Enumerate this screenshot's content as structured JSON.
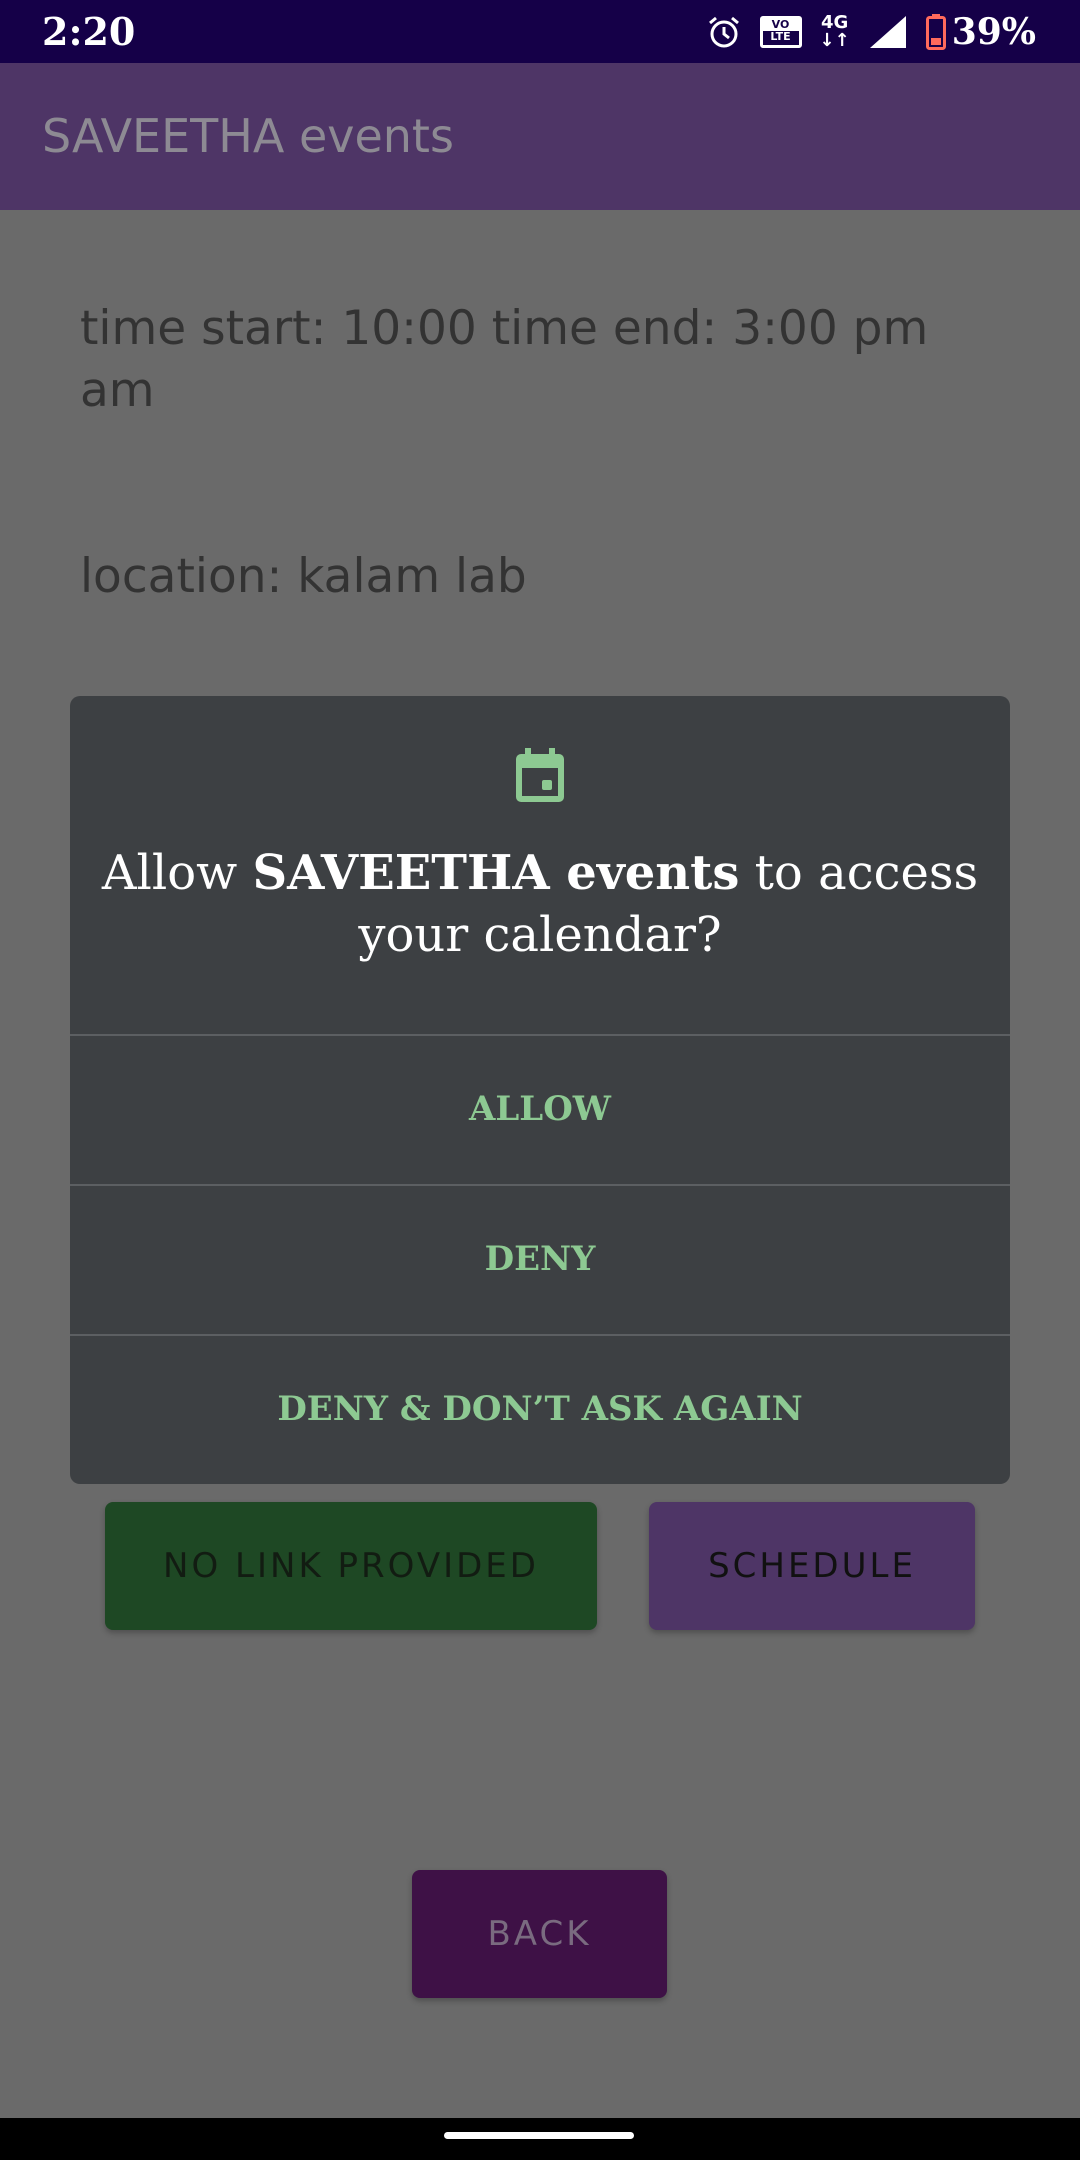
{
  "status_bar": {
    "time": "2:20",
    "volte_top": "VO",
    "volte_bottom": "LTE",
    "network": "4G",
    "network_arrows": "↓↑",
    "battery_percent": "39%",
    "icons": [
      "alarm-icon",
      "volte-icon",
      "network-4g-icon",
      "signal-icon",
      "battery-low-icon"
    ]
  },
  "app_bar": {
    "title": "SAVEETHA events"
  },
  "event": {
    "time_line": "time start: 10:00  time end: 3:00 pm am",
    "location_line": "location: kalam lab"
  },
  "buttons": {
    "no_link": "NO LINK PROVIDED",
    "schedule": "SCHEDULE",
    "back": "BACK"
  },
  "permission_dialog": {
    "icon": "calendar-icon",
    "title_prefix": "Allow ",
    "title_app": "SAVEETHA events",
    "title_suffix": " to access your calendar?",
    "options": {
      "allow": "ALLOW",
      "deny": "DENY",
      "deny_never": "DENY & DON’T ASK AGAIN"
    }
  },
  "colors": {
    "status_bar": "#150048",
    "app_bar": "#4e3566",
    "dialog_background": "#3d4043",
    "dialog_accent": "#8dc992",
    "scrim_background": "#6a6a6a"
  }
}
